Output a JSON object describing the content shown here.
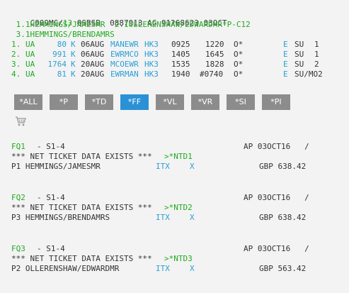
{
  "header": {
    "record_prefix": "C009MG/",
    "record_num": "13",
    "record_rest": " QSBSB  0887913 AG 91268623 03OCT"
  },
  "passengers": {
    "line1_a": " 1.1HEMMINGS/JAMESMR  2.1OLLERENSHAW/EDWARDMR*P-C12",
    "line2": " 3.1HEMMINGS/BRENDAMRS"
  },
  "segments": [
    {
      "num": "1.",
      "airline": "UA",
      "flight": "80",
      "cls": "K",
      "date": "06AUG",
      "route": "MANEWR",
      "status": "HK3",
      "dep": "0925",
      "arr": "1220",
      "extra": "",
      "opt": "O*",
      "e": "E",
      "day": "SU",
      "stop": "1"
    },
    {
      "num": "2.",
      "airline": "UA",
      "flight": "991",
      "cls": "K",
      "date": "06AUG",
      "route": "EWRMCO",
      "status": "HK3",
      "dep": "1405",
      "arr": "1645",
      "extra": "",
      "opt": "O*",
      "e": "E",
      "day": "SU",
      "stop": "1"
    },
    {
      "num": "3.",
      "airline": "UA",
      "flight": "1764",
      "cls": "K",
      "date": "20AUG",
      "route": "MCOEWR",
      "status": "HK3",
      "dep": "1535",
      "arr": "1828",
      "extra": "",
      "opt": "O*",
      "e": "E",
      "day": "SU",
      "stop": "2"
    },
    {
      "num": "4.",
      "airline": "UA",
      "flight": "81",
      "cls": "K",
      "date": "20AUG",
      "route": "EWRMAN",
      "status": "HK3",
      "dep": "1940",
      "arr": "",
      "extra": "#0740",
      "opt": "O*",
      "e": "E",
      "day": "SU/MO2",
      "stop": ""
    }
  ],
  "toolbar": {
    "buttons": [
      "*ALL",
      "*P",
      "*TD",
      "*FF",
      "*VL",
      "*VR",
      "*SI",
      "*PI"
    ],
    "active": "*FF",
    "active_color": "#2b91d6",
    "inactive_color": "#8c8c8c"
  },
  "icons": {
    "cart": "shopping-cart-icon"
  },
  "fares": [
    {
      "fq": "FQ1",
      "seg": "- S1-4",
      "ap": "AP 03OCT16   /",
      "net_text": "*** NET TICKET DATA EXISTS ***",
      "net_link": ">*NTD1",
      "pax": "P1 HEMMINGS/JAMESMR",
      "itx": "ITX",
      "x": "X",
      "price": "GBP 638.42"
    },
    {
      "fq": "FQ2",
      "seg": "- S1-4",
      "ap": "AP 03OCT16   /",
      "net_text": "*** NET TICKET DATA EXISTS ***",
      "net_link": ">*NTD2",
      "pax": "P3 HEMMINGS/BRENDAMRS",
      "itx": "ITX",
      "x": "X",
      "price": "GBP 638.42"
    },
    {
      "fq": "FQ3",
      "seg": "- S1-4",
      "ap": "AP 03OCT16   /",
      "net_text": "*** NET TICKET DATA EXISTS ***",
      "net_link": ">*NTD3",
      "pax": "P2 OLLERENSHAW/EDWARDMR",
      "itx": "ITX",
      "x": "X",
      "price": "GBP 563.42"
    }
  ],
  "colors": {
    "green": "#22aa22",
    "blue": "#2a9fd6",
    "text": "#333333",
    "background": "#f3f3f3"
  }
}
